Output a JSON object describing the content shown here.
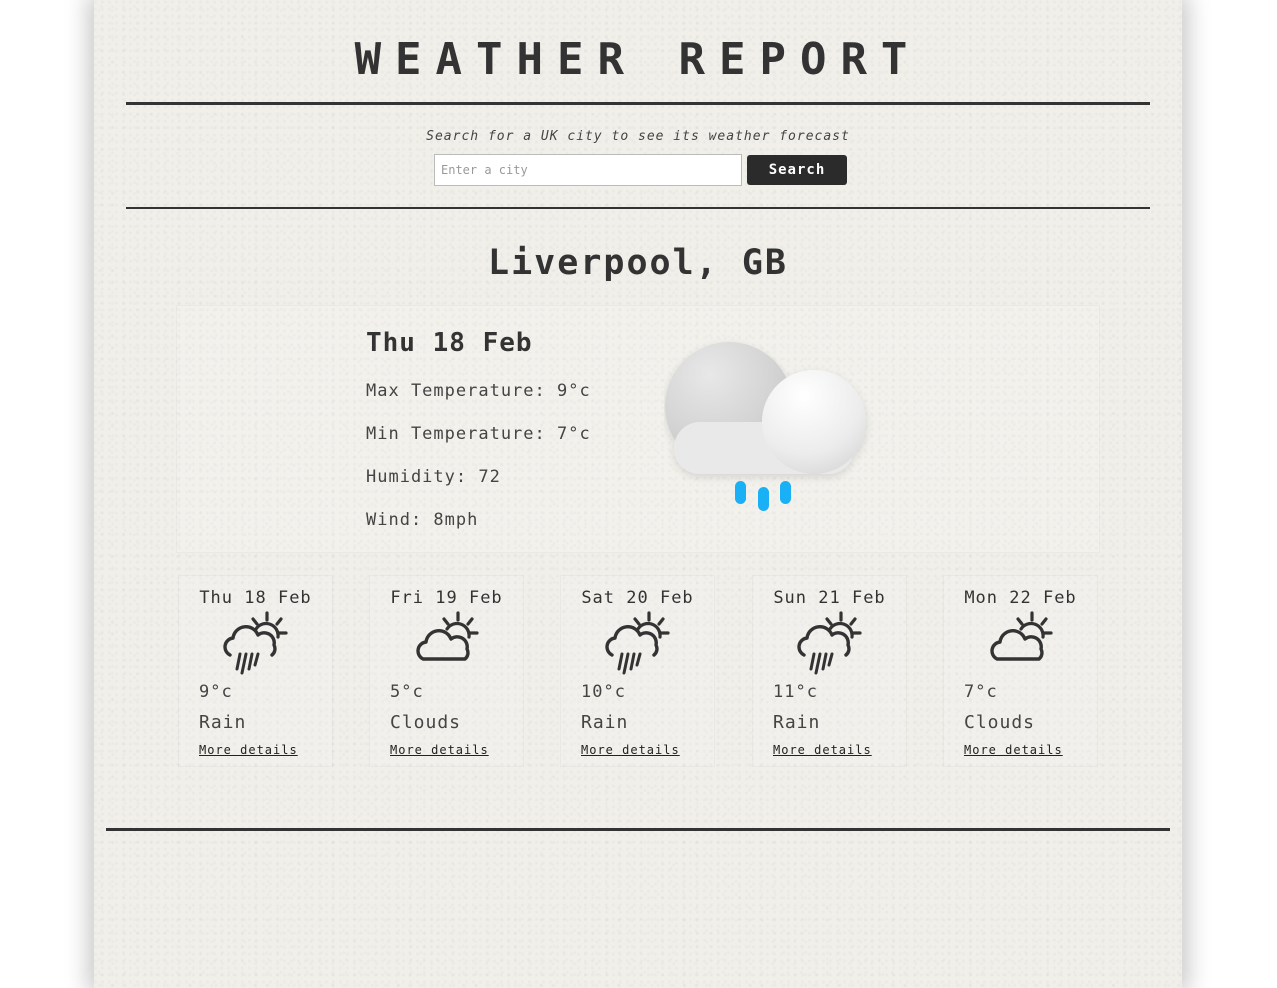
{
  "header": {
    "title": "WEATHER REPORT"
  },
  "search": {
    "prompt": "Search for a UK city to see its weather forecast",
    "placeholder": "Enter a city",
    "button_label": "Search"
  },
  "location": {
    "name": "Liverpool, GB"
  },
  "today": {
    "date": "Thu 18 Feb",
    "max_temp": "Max Temperature: 9°c",
    "min_temp": "Min Temperature: 7°c",
    "humidity": "Humidity: 72",
    "wind": "Wind: 8mph",
    "icon": "rain-cloud-icon",
    "rain_color": "#1ab0f5"
  },
  "forecast": [
    {
      "date": "Thu 18 Feb",
      "temp": "9°c",
      "desc": "Rain",
      "link": "More details",
      "icon": "cloud-sun-rain-icon"
    },
    {
      "date": "Fri 19 Feb",
      "temp": "5°c",
      "desc": "Clouds",
      "link": "More details",
      "icon": "cloud-sun-icon"
    },
    {
      "date": "Sat 20 Feb",
      "temp": "10°c",
      "desc": "Rain",
      "link": "More details",
      "icon": "cloud-sun-rain-icon"
    },
    {
      "date": "Sun 21 Feb",
      "temp": "11°c",
      "desc": "Rain",
      "link": "More details",
      "icon": "cloud-sun-rain-icon"
    },
    {
      "date": "Mon 22 Feb",
      "temp": "7°c",
      "desc": "Clouds",
      "link": "More details",
      "icon": "cloud-sun-icon"
    }
  ]
}
